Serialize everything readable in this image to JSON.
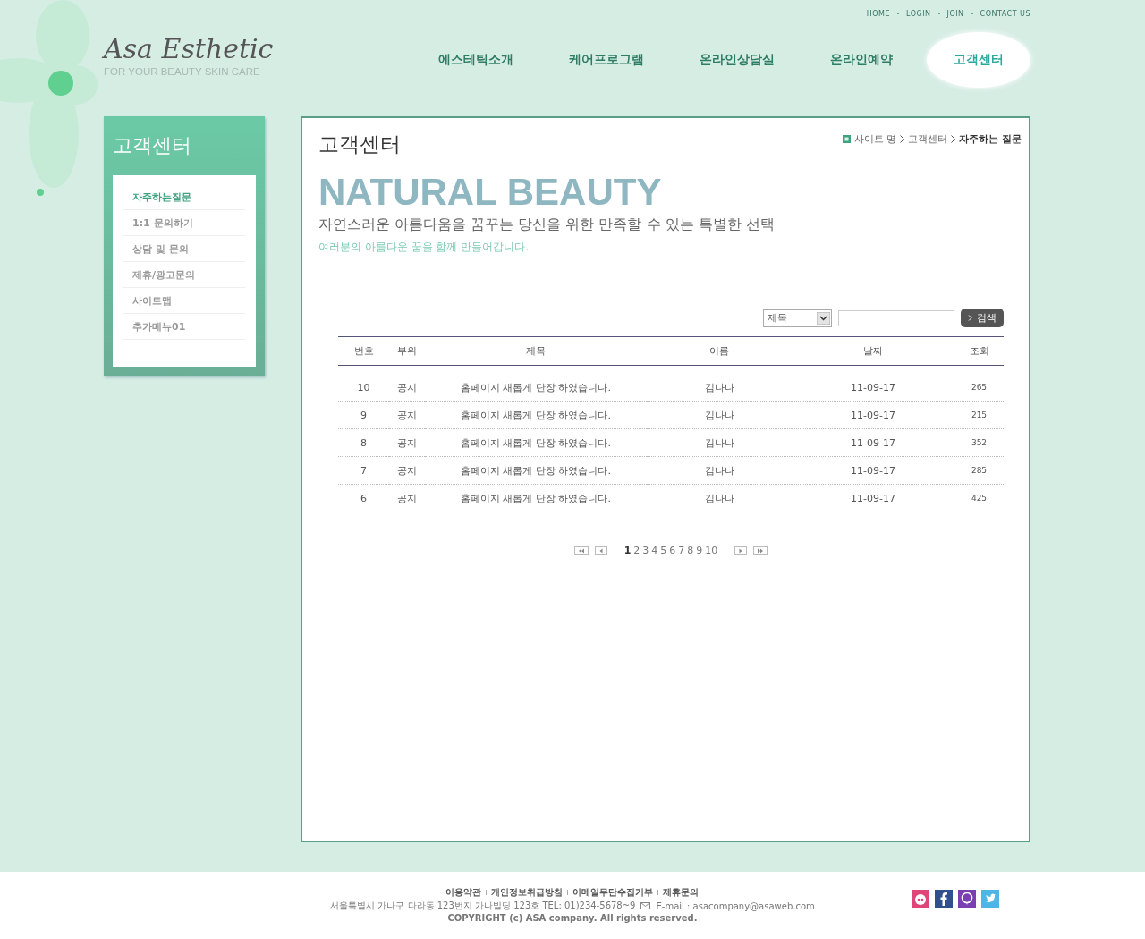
{
  "top_links": [
    "HOME",
    "LOGIN",
    "JOIN",
    "CONTACT US"
  ],
  "logo": {
    "name": "Asa Esthetic",
    "tagline": "FOR YOUR BEAUTY SKIN CARE"
  },
  "nav": [
    {
      "label": "에스테틱소개",
      "selected": false
    },
    {
      "label": "케어프로그램",
      "selected": false
    },
    {
      "label": "온라인상담실",
      "selected": false
    },
    {
      "label": "온라인예약",
      "selected": false
    },
    {
      "label": "고객센터",
      "selected": true
    }
  ],
  "sidebar": {
    "title": "고객센터",
    "items": [
      {
        "label": "자주하는질문",
        "selected": true
      },
      {
        "label": "1:1 문의하기",
        "selected": false
      },
      {
        "label": "상담 및 문의",
        "selected": false
      },
      {
        "label": "제휴/광고문의",
        "selected": false
      },
      {
        "label": "사이트맵",
        "selected": false
      },
      {
        "label": "추가메뉴01",
        "selected": false
      }
    ]
  },
  "page_title": "고객센터",
  "breadcrumb": [
    {
      "label": "사이트 명",
      "current": false
    },
    {
      "label": "고객센터",
      "current": false
    },
    {
      "label": "자주하는 질문",
      "current": true
    }
  ],
  "banner": {
    "headline": "NATURAL BEAUTY",
    "subtitle": "자연스러운 아름다움을 꿈꾸는 당신을 위한 만족할 수 있는 특별한 선택",
    "caption": "여러분의 아름다운 꿈을 함께 만들어갑니다."
  },
  "search": {
    "field_select": "제목",
    "button": "검색"
  },
  "table": {
    "columns": [
      "번호",
      "부위",
      "제목",
      "이름",
      "날짜",
      "조회"
    ],
    "rows": [
      [
        "10",
        "공지",
        "홈페이지 새롭게 단장 하였습니다.",
        "김나나",
        "11-09-17",
        "265"
      ],
      [
        "9",
        "공지",
        "홈페이지 새롭게 단장 하였습니다.",
        "김나나",
        "11-09-17",
        "215"
      ],
      [
        "8",
        "공지",
        "홈페이지 새롭게 단장 하였습니다.",
        "김나나",
        "11-09-17",
        "352"
      ],
      [
        "7",
        "공지",
        "홈페이지 새롭게 단장 하였습니다.",
        "김나나",
        "11-09-17",
        "285"
      ],
      [
        "6",
        "공지",
        "홈페이지 새롭게 단장 하였습니다.",
        "김나나",
        "11-09-17",
        "425"
      ]
    ]
  },
  "pagination": [
    {
      "label": "1",
      "selected": true
    },
    {
      "label": "2",
      "selected": false
    },
    {
      "label": "3",
      "selected": false
    },
    {
      "label": "4",
      "selected": false
    },
    {
      "label": "5",
      "selected": false
    },
    {
      "label": "6",
      "selected": false
    },
    {
      "label": "7",
      "selected": false
    },
    {
      "label": "8",
      "selected": false
    },
    {
      "label": "9",
      "selected": false
    },
    {
      "label": "10",
      "selected": false
    }
  ],
  "footer": {
    "links": [
      "이용약관",
      "개인정보취급방침",
      "이메일무단수집거부",
      "제휴문의"
    ],
    "address": "서울특별시 가나구 다라동  123번지 가나빌딩 123호  TEL: 01)234-5678~9",
    "email": "E-mail : asacompany@asaweb.com",
    "copyright": "COPYRIGHT (c) ASA company. All rights reserved."
  }
}
